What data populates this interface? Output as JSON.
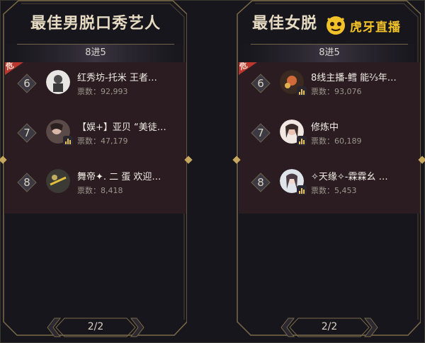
{
  "panels": [
    {
      "title": "最佳男脱口秀艺人",
      "subtitle": "8进5",
      "danger_label": "危",
      "rows": [
        {
          "rank": "6",
          "name": "红秀坊-托米 王者…",
          "votes": "票数：92,993"
        },
        {
          "rank": "7",
          "name": "【娱+】亚贝 “美徒…",
          "votes": "票数：47,179"
        },
        {
          "rank": "8",
          "name": "舞帝✦. 二 蛋 欢迎…",
          "votes": "票数：8,418"
        }
      ],
      "pager": "2/2"
    },
    {
      "title": "最佳女脱",
      "subtitle": "8进5",
      "danger_label": "危",
      "rows": [
        {
          "rank": "6",
          "name": "8线主播-鳕 能⅔年…",
          "votes": "票数：93,076"
        },
        {
          "rank": "7",
          "name": "修炼中",
          "votes": "票数：60,189"
        },
        {
          "rank": "8",
          "name": "✧天缘✧-霖霖幺 …",
          "votes": "票数：5,453"
        }
      ],
      "pager": "2/2"
    }
  ],
  "watermark": {
    "text": "虎牙直播",
    "icon": "tiger-face-icon"
  },
  "colors": {
    "gold": "#c7a85e",
    "title": "#e7dcc3",
    "row_bg": "#2a1c20",
    "danger": "#b9372e"
  }
}
